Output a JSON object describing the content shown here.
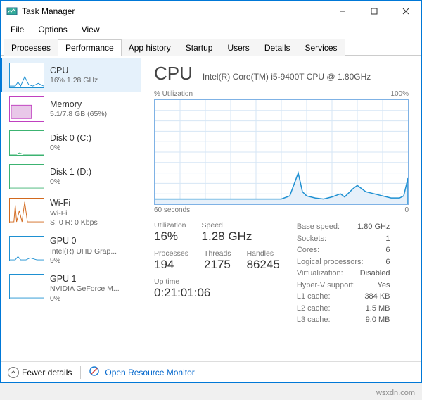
{
  "window": {
    "title": "Task Manager"
  },
  "menu": {
    "file": "File",
    "options": "Options",
    "view": "View"
  },
  "tabs": {
    "processes": "Processes",
    "performance": "Performance",
    "app_history": "App history",
    "startup": "Startup",
    "users": "Users",
    "details": "Details",
    "services": "Services"
  },
  "sidebar": [
    {
      "title": "CPU",
      "sub": "16% 1.28 GHz",
      "color": "#1e90d2"
    },
    {
      "title": "Memory",
      "sub": "5.1/7.8 GB (65%)",
      "color": "#c040c0"
    },
    {
      "title": "Disk 0 (C:)",
      "sub": "0%",
      "color": "#3cb371"
    },
    {
      "title": "Disk 1 (D:)",
      "sub": "0%",
      "color": "#3cb371"
    },
    {
      "title": "Wi-Fi",
      "sub1": "Wi-Fi",
      "sub2": "S: 0 R: 0 Kbps",
      "color": "#d2691e"
    },
    {
      "title": "GPU 0",
      "sub1": "Intel(R) UHD Grap...",
      "sub2": "9%",
      "color": "#1e90d2"
    },
    {
      "title": "GPU 1",
      "sub1": "NVIDIA GeForce M...",
      "sub2": "0%",
      "color": "#1e90d2"
    }
  ],
  "detail": {
    "heading": "CPU",
    "chip_name": "Intel(R) Core(TM) i5-9400T CPU @ 1.80GHz",
    "chart_top_left": "% Utilization",
    "chart_top_right": "100%",
    "chart_bottom_left": "60 seconds",
    "chart_bottom_right": "0",
    "left_stats": {
      "utilization": {
        "label": "Utilization",
        "value": "16%"
      },
      "speed": {
        "label": "Speed",
        "value": "1.28 GHz"
      },
      "processes": {
        "label": "Processes",
        "value": "194"
      },
      "threads": {
        "label": "Threads",
        "value": "2175"
      },
      "handles": {
        "label": "Handles",
        "value": "86245"
      },
      "uptime": {
        "label": "Up time",
        "value": "0:21:01:06"
      }
    },
    "right_stats": [
      {
        "k": "Base speed:",
        "v": "1.80 GHz"
      },
      {
        "k": "Sockets:",
        "v": "1"
      },
      {
        "k": "Cores:",
        "v": "6"
      },
      {
        "k": "Logical processors:",
        "v": "6"
      },
      {
        "k": "Virtualization:",
        "v": "Disabled"
      },
      {
        "k": "Hyper-V support:",
        "v": "Yes"
      },
      {
        "k": "L1 cache:",
        "v": "384 KB"
      },
      {
        "k": "L2 cache:",
        "v": "1.5 MB"
      },
      {
        "k": "L3 cache:",
        "v": "9.0 MB"
      }
    ]
  },
  "footer": {
    "fewer": "Fewer details",
    "orm": "Open Resource Monitor"
  },
  "watermark": "wsxdn.com",
  "chart_data": {
    "type": "line",
    "title": "% Utilization",
    "xlabel": "60 seconds",
    "ylabel": "% Utilization",
    "ylim": [
      0,
      100
    ],
    "x_seconds_ago": [
      60,
      55,
      50,
      45,
      40,
      35,
      30,
      28,
      26,
      25,
      24,
      22,
      20,
      18,
      16,
      15,
      13,
      12,
      10,
      8,
      6,
      5,
      4,
      3,
      2,
      1,
      0
    ],
    "utilization_pct": [
      5,
      5,
      5,
      5,
      5,
      5,
      5,
      8,
      30,
      12,
      8,
      6,
      5,
      7,
      10,
      7,
      15,
      18,
      12,
      10,
      8,
      7,
      6,
      6,
      6,
      8,
      25
    ]
  }
}
